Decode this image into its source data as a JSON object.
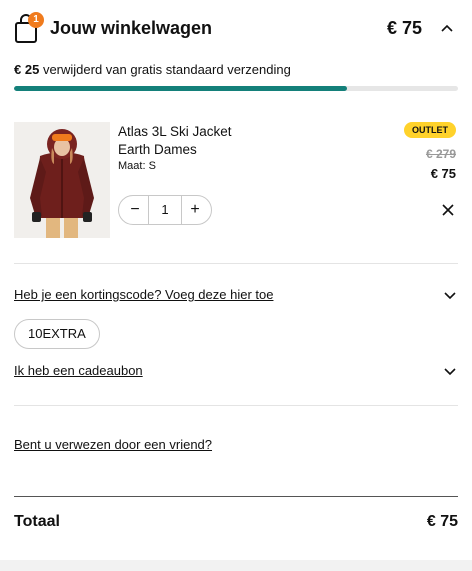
{
  "header": {
    "title": "Jouw winkelwagen",
    "total": "€ 75",
    "cart_count": "1"
  },
  "shipping": {
    "amount": "€ 25",
    "message": "verwijderd van gratis standaard verzending",
    "progress_fraction": 0.75
  },
  "item": {
    "name_line1": "Atlas 3L Ski Jacket",
    "name_line2": "Earth Dames",
    "size": "Maat: S",
    "badge": "OUTLET",
    "old_price": "€ 279",
    "price": "€ 75",
    "quantity": "1",
    "minus": "−",
    "plus": "+"
  },
  "discount": {
    "link": "Heb je een kortingscode? Voeg deze hier toe",
    "applied_code": "10EXTRA"
  },
  "giftcard": {
    "link": "Ik heb een cadeaubon"
  },
  "referral": {
    "link": "Bent u verwezen door een vriend?"
  },
  "summary": {
    "label": "Totaal",
    "value": "€ 75"
  },
  "colors": {
    "accent": "#14807a",
    "badge_orange": "#f07b1d",
    "outlet_yellow": "#ffd22b"
  }
}
